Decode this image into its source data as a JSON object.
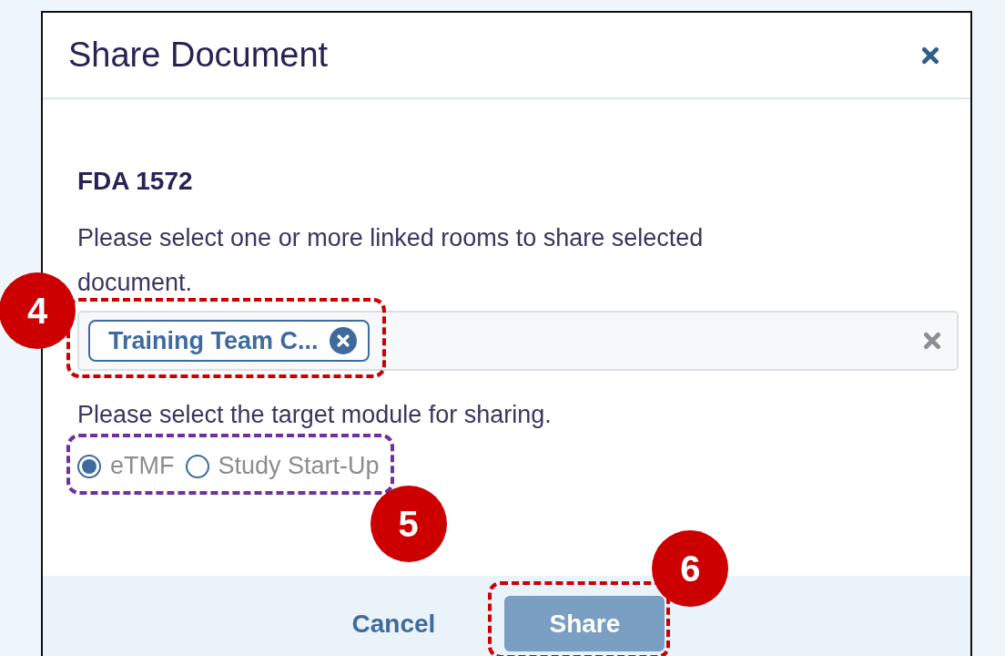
{
  "dialog": {
    "title": "Share Document"
  },
  "document_name": "FDA 1572",
  "rooms_prompt": "Please select one or more linked rooms to share selected document.",
  "rooms_field": {
    "chips": [
      {
        "label": "Training Team C..."
      }
    ]
  },
  "module_prompt": "Please select the target module for sharing.",
  "modules": [
    {
      "label": "eTMF",
      "selected": true
    },
    {
      "label": "Study Start-Up",
      "selected": false
    }
  ],
  "buttons": [
    {
      "label": "Cancel",
      "kind": "link"
    },
    {
      "label": "Share",
      "kind": "primary"
    }
  ],
  "callouts": [
    {
      "number": "4",
      "kind": "chip",
      "color": "#cc0000"
    },
    {
      "number": "5",
      "kind": "modules",
      "color": "#7030a0"
    },
    {
      "number": "6",
      "kind": "share",
      "color": "#cc0000"
    }
  ]
}
